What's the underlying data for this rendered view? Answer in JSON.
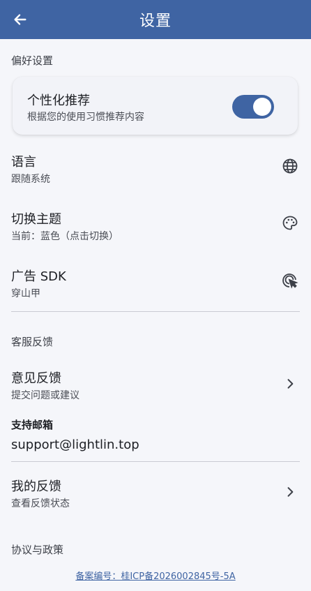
{
  "appbar": {
    "title": "设置",
    "back_icon": "arrow-left-icon"
  },
  "preferences": {
    "header": "偏好设置",
    "personalized": {
      "title": "个性化推荐",
      "subtitle": "根据您的使用习惯推荐内容",
      "enabled": true
    }
  },
  "settings": [
    {
      "title": "语言",
      "subtitle": "跟随系统",
      "icon": "globe-icon"
    },
    {
      "title": "切换主题",
      "subtitle": "当前：蓝色（点击切换）",
      "icon": "palette-icon"
    },
    {
      "title": "广告 SDK",
      "subtitle": "穿山甲",
      "icon": "ad-click-icon"
    }
  ],
  "support": {
    "header": "客服反馈",
    "feedback": {
      "title": "意见反馈",
      "subtitle": "提交问题或建议",
      "icon": "chevron-right-icon"
    },
    "email_label": "支持邮箱",
    "email": "support@lightlin.top",
    "my_feedback": {
      "title": "我的反馈",
      "subtitle": "查看反馈状态",
      "icon": "chevron-right-icon"
    }
  },
  "policy": {
    "header": "协议与政策"
  },
  "footer": {
    "icp": "备案编号：桂ICP备2026002845号-5A"
  },
  "colors": {
    "primary": "#3f64a3",
    "background": "#f5f6fa",
    "divider": "#c9cbd3"
  }
}
